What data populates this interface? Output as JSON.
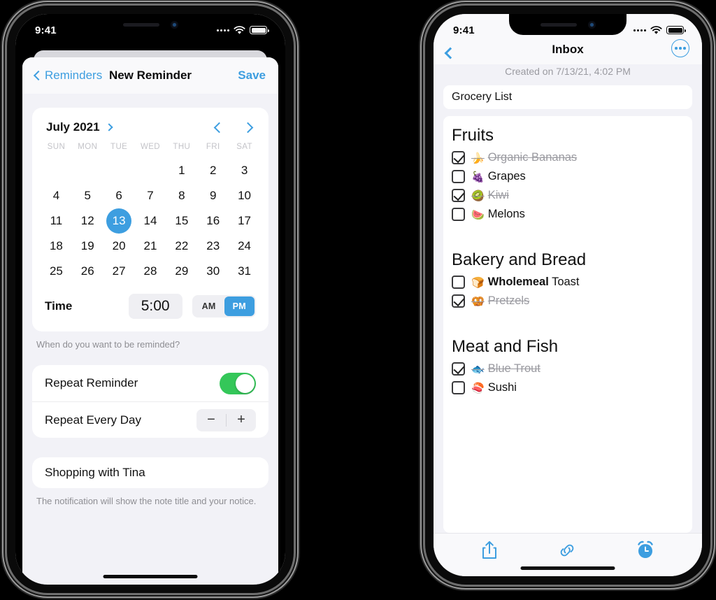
{
  "status_bar": {
    "time": "9:41",
    "icons": [
      "signal-dots-icon",
      "wifi-icon",
      "battery-icon"
    ]
  },
  "left_phone": {
    "nav": {
      "back_label": "Reminders",
      "back_icon": "chevron-left-icon",
      "title": "New Reminder",
      "save_label": "Save"
    },
    "calendar": {
      "month_label": "July 2021",
      "month_chevron_icon": "chevron-right-icon",
      "prev_icon": "chevron-left-icon",
      "next_icon": "chevron-right-icon",
      "weekdays": [
        "SUN",
        "MON",
        "TUE",
        "WED",
        "THU",
        "FRI",
        "SAT"
      ],
      "leading_blanks": 4,
      "days": [
        1,
        2,
        3,
        4,
        5,
        6,
        7,
        8,
        9,
        10,
        11,
        12,
        13,
        14,
        15,
        16,
        17,
        18,
        19,
        20,
        21,
        22,
        23,
        24,
        25,
        26,
        27,
        28,
        29,
        30,
        31
      ],
      "selected_day": 13
    },
    "time_row": {
      "label": "Time",
      "value": "5:00",
      "am_label": "AM",
      "pm_label": "PM",
      "selected_period": "PM"
    },
    "footnote": "When do you want to be reminded?",
    "repeat": {
      "reminder_label": "Repeat Reminder",
      "reminder_on": true,
      "every_label": "Repeat Every Day",
      "minus_label": "−",
      "plus_label": "+"
    },
    "note": {
      "title": "Shopping with Tina",
      "footnote": "The notification will show the note title and your notice."
    },
    "colors": {
      "accent": "#3d9ee0",
      "toggle_on": "#34c759",
      "sheet_bg": "#f2f2f7"
    }
  },
  "right_phone": {
    "nav": {
      "back_icon": "chevron-left-icon",
      "title": "Inbox",
      "more_icon": "ellipsis-circle-icon"
    },
    "created": "Created on 7/13/21, 4:02 PM",
    "note_title": "Grocery List",
    "sections": [
      {
        "heading": "Fruits",
        "items": [
          {
            "emoji": "🍌",
            "text": "Organic Bananas",
            "checked": true
          },
          {
            "emoji": "🍇",
            "text": "Grapes",
            "checked": false
          },
          {
            "emoji": "🥝",
            "text": "Kiwi",
            "checked": true
          },
          {
            "emoji": "🍉",
            "text": "Melons",
            "checked": false
          }
        ]
      },
      {
        "heading": "Bakery and Bread",
        "items": [
          {
            "emoji": "🍞",
            "text": "Wholemeal Toast",
            "bold_prefix": "Wholemeal",
            "checked": false
          },
          {
            "emoji": "🥨",
            "text": "Pretzels",
            "checked": true
          }
        ]
      },
      {
        "heading": "Meat and Fish",
        "items": [
          {
            "emoji": "🐟",
            "text": "Blue Trout",
            "checked": true
          },
          {
            "emoji": "🍣",
            "text": "Sushi",
            "checked": false
          }
        ]
      }
    ],
    "toolbar": {
      "share_icon": "share-icon",
      "link_icon": "link-icon",
      "alarm_icon": "alarm-clock-icon"
    },
    "colors": {
      "accent": "#3d9ee0"
    }
  }
}
